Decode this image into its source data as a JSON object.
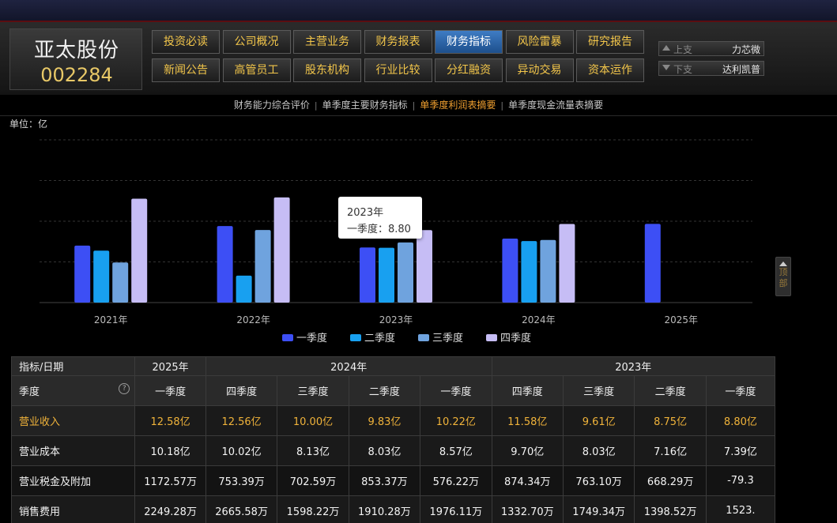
{
  "stock": {
    "name": "亚太股份",
    "code": "002284"
  },
  "nav": {
    "row1": [
      "投资必读",
      "公司概况",
      "主营业务",
      "财务报表",
      "财务指标",
      "风险雷暴",
      "研究报告"
    ],
    "row2": [
      "新闻公告",
      "高管员工",
      "股东机构",
      "行业比较",
      "分红融资",
      "异动交易",
      "资本运作"
    ],
    "active": "财务指标"
  },
  "neighbors": {
    "prev_label": "上支",
    "prev_name": "力芯微",
    "next_label": "下支",
    "next_name": "达利凯普"
  },
  "subnav": {
    "items": [
      "财务能力综合评价",
      "单季度主要财务指标",
      "单季度利润表摘要",
      "单季度现金流量表摘要"
    ],
    "active": "单季度利润表摘要",
    "separator": "|"
  },
  "unit_label": "单位：亿",
  "scroll_top": {
    "label_1": "顶",
    "label_2": "部"
  },
  "tooltip": {
    "year": "2023年",
    "text": "一季度：8.80"
  },
  "colors": {
    "q1": "#3d4ff5",
    "q2": "#18a0f0",
    "q3": "#6fa3de",
    "q4": "#c6bdf5",
    "accent": "#f0b33a"
  },
  "chart_data": {
    "type": "bar",
    "categories": [
      "2021年",
      "2022年",
      "2023年",
      "2024年",
      "2025年"
    ],
    "series": [
      {
        "name": "一季度",
        "values": [
          9.11,
          12.23,
          8.8,
          10.22,
          12.58
        ]
      },
      {
        "name": "二季度",
        "values": [
          8.3,
          4.3,
          8.75,
          9.83,
          null
        ]
      },
      {
        "name": "三季度",
        "values": [
          6.4,
          11.6,
          9.61,
          10.0,
          null
        ]
      },
      {
        "name": "四季度",
        "values": [
          16.6,
          16.8,
          11.58,
          12.56,
          null
        ]
      }
    ],
    "ylim": [
      0,
      26
    ],
    "grid": true,
    "legend": "bottom"
  },
  "table": {
    "header_label": "指标/日期",
    "season_label": "季度",
    "help": "?",
    "years": [
      {
        "label": "2025年",
        "span": 1
      },
      {
        "label": "2024年",
        "span": 4
      },
      {
        "label": "2023年",
        "span": 4
      }
    ],
    "seasons": [
      "一季度",
      "四季度",
      "三季度",
      "二季度",
      "一季度",
      "四季度",
      "三季度",
      "二季度",
      "一季度"
    ],
    "rows": [
      {
        "label": "营业收入",
        "values": [
          "12.58亿",
          "12.56亿",
          "10.00亿",
          "9.83亿",
          "10.22亿",
          "11.58亿",
          "9.61亿",
          "8.75亿",
          "8.80亿"
        ]
      },
      {
        "label": "营业成本",
        "values": [
          "10.18亿",
          "10.02亿",
          "8.13亿",
          "8.03亿",
          "8.57亿",
          "9.70亿",
          "8.03亿",
          "7.16亿",
          "7.39亿"
        ]
      },
      {
        "label": "营业税金及附加",
        "values": [
          "1172.57万",
          "753.39万",
          "702.59万",
          "853.37万",
          "576.22万",
          "874.34万",
          "763.10万",
          "668.29万",
          "-79.3"
        ]
      },
      {
        "label": "销售费用",
        "values": [
          "2249.28万",
          "2665.58万",
          "1598.22万",
          "1910.28万",
          "1976.11万",
          "1332.70万",
          "1749.34万",
          "1398.52万",
          "1523."
        ]
      }
    ]
  }
}
